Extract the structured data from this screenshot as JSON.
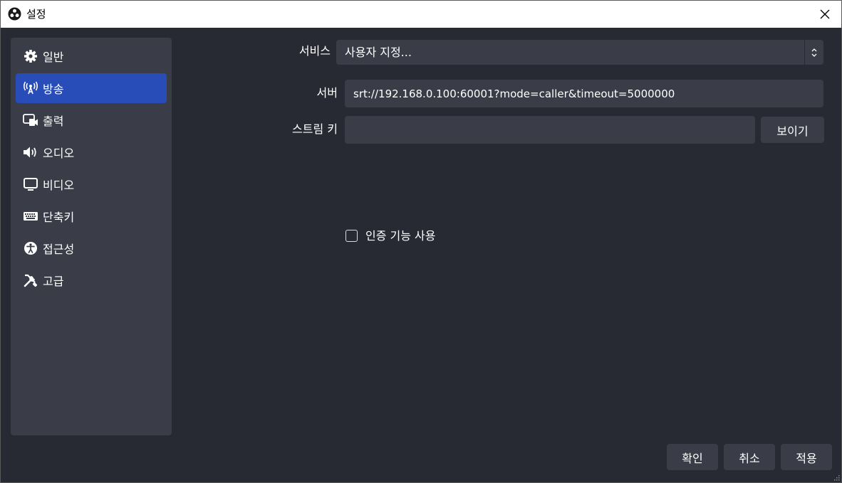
{
  "window": {
    "title": "설정"
  },
  "sidebar": {
    "items": [
      {
        "label": "일반",
        "icon": "gear-icon"
      },
      {
        "label": "방송",
        "icon": "broadcast-icon"
      },
      {
        "label": "출력",
        "icon": "output-icon"
      },
      {
        "label": "오디오",
        "icon": "speaker-icon"
      },
      {
        "label": "비디오",
        "icon": "monitor-icon"
      },
      {
        "label": "단축키",
        "icon": "keyboard-icon"
      },
      {
        "label": "접근성",
        "icon": "accessibility-icon"
      },
      {
        "label": "고급",
        "icon": "tools-icon"
      }
    ],
    "active_index": 1
  },
  "stream": {
    "service_label": "서비스",
    "service_value": "사용자 지정...",
    "server_label": "서버",
    "server_value": "srt://192.168.0.100:60001?mode=caller&timeout=5000000",
    "stream_key_label": "스트림 키",
    "stream_key_value": "",
    "show_button": "보이기",
    "auth_checkbox_label": "인증 기능 사용",
    "auth_checked": false
  },
  "footer": {
    "ok": "확인",
    "cancel": "취소",
    "apply": "적용"
  },
  "colors": {
    "background": "#272a33",
    "panel": "#3a3d48",
    "accent": "#284cb8",
    "text": "#ffffff"
  }
}
